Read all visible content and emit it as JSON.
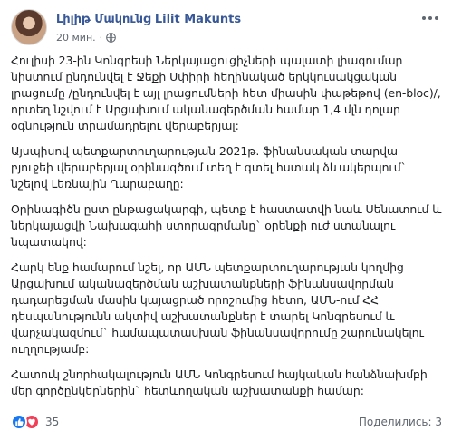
{
  "post": {
    "author": "Լիլիթ Մակունց Lilit Makunts",
    "time": "20 мин.",
    "visibility_separator": "·",
    "icons": {
      "visibility": "globe-icon",
      "more": "more-horizontal-icon"
    },
    "paragraphs": [
      "Հուլիսի 23-ին Կոնգրեսի Ներկայացուցիչների պալատի լիագումար նիստում ընդունվել է Ջեքի Սփիրի հեղինակած երկկուսակցական լրացումը /ընդունվել է այլ լրացումների հետ միասին փաթեթով (en-bloc)/, որտեղ նշվում է Արցախում ականազերծման համար 1,4 մլն դոլար օգնություն տրամադրելու վերաբերյալ:",
      "Այսպիսով պետքարտուղարության 2021թ. ֆինանսական տարվա բյուջեի վերաբերյալ օրինագծում տեղ է գտել հստակ ձևակերպում` նշելով Լեռնային Ղարաբաղը:",
      "Օրինագիծն ըստ ընթացակարգի, պետք է հաստատվի նաև Սենատում և ներկայացվի Նախագահի ստորագրմանը` օրենքի ուժ ստանալու նպատակով:",
      "Հարկ ենք համարում նշել, որ ԱՄՆ պետքարտուղարության կողմից Արցախում ականազերծման աշխատանքների ֆինանսավորման դադարեցման մասին կայացրած որոշումից հետո, ԱՄՆ-ում ՀՀ դեսպանությունն ակտիվ աշխատանքներ է տարել Կոնգրեսում և վարչակազմում` համապատասխան ֆինանսավորումը շարունակելու ուղղությամբ:",
      "Հատուկ շնորհակալություն ԱՄՆ Կոնգրեսում հայկական հանձնախմբի մեր գործընկերներին` հետևողական աշխատանքի համար:"
    ]
  },
  "footer": {
    "reaction_count": "35",
    "shares_label": "Поделились: 3",
    "reaction_icons": [
      "like-icon",
      "love-icon"
    ],
    "colors": {
      "like": "#1877f2",
      "love": "#f33e58",
      "author": "#385898"
    }
  }
}
